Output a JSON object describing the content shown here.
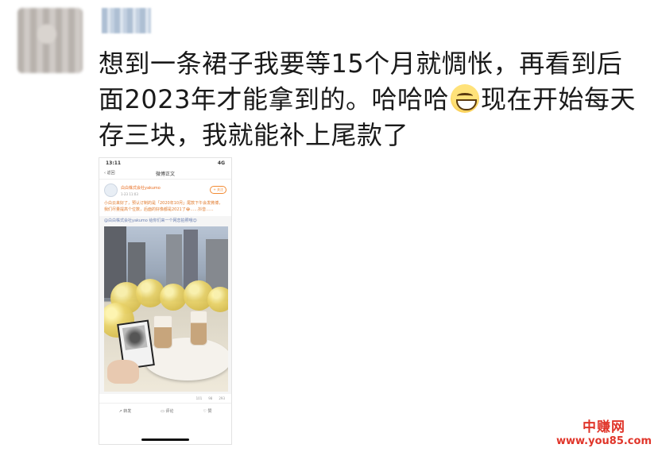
{
  "post": {
    "text_part1": "想到一条裙子我要等15个月就惆怅，再看到后面2023年才能拿到的。哈哈哈",
    "emoji": "grinning-emoji",
    "text_part2": "现在开始每天存三块，我就能补上尾款了"
  },
  "phone": {
    "status_time": "13:11",
    "status_signal": "4G",
    "nav_back": "返回",
    "nav_title": "微博正文",
    "weibo": {
      "author": "白白株式会社yakumo",
      "time": "1-23 11:03",
      "follow": "+ 关注",
      "text": "小白云来好了，预认订制的是「2020年10月」尾款下午会发微博，我们尽量提高个位数，后面的好像都是2021了😂......抖音......",
      "retweet_text": "@白白株式会社yakumo 给你们来一个网恋拍照哦😉"
    },
    "stats": [
      "101",
      "98",
      "293"
    ],
    "actions": [
      "转发",
      "评论",
      "赞"
    ]
  },
  "watermark": {
    "title": "中赚网",
    "url": "www.you85.com"
  }
}
